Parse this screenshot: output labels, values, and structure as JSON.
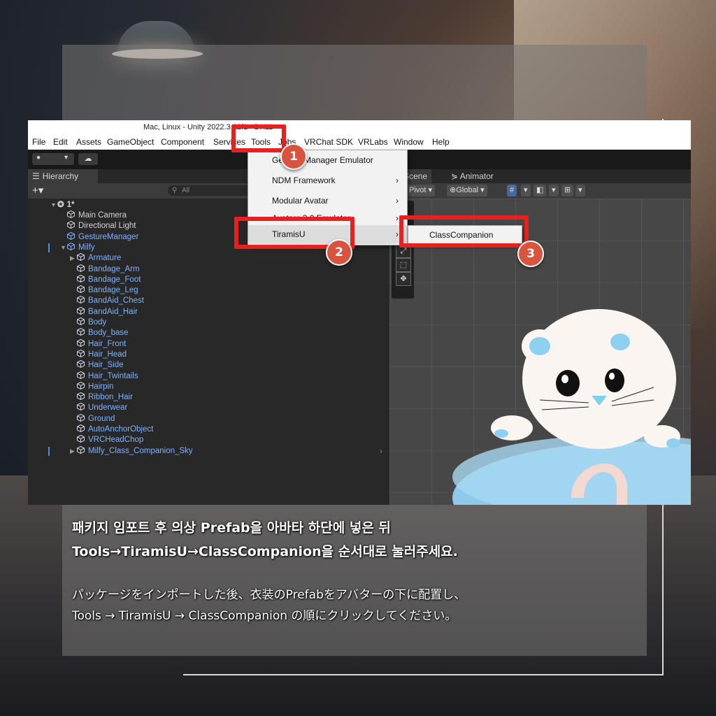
{
  "window": {
    "title": "Mac, Linux - Unity 2022.3.22f1 <DX11>"
  },
  "menubar": {
    "items": [
      "File",
      "Edit",
      "Assets",
      "GameObject",
      "Component",
      "Services",
      "Tools",
      "Jobs",
      "VRChat SDK",
      "VRLabs",
      "Window",
      "Help"
    ]
  },
  "hierarchy": {
    "tab_label": "Hierarchy",
    "search_placeholder": "All",
    "scene_name": "1*",
    "items": [
      {
        "label": "Main Camera",
        "depth": 1,
        "prefab": false
      },
      {
        "label": "Directional Light",
        "depth": 1,
        "prefab": false
      },
      {
        "label": "GestureManager",
        "depth": 1,
        "prefab": true
      },
      {
        "label": "Milfy",
        "depth": 1,
        "prefab": true
      },
      {
        "label": "Armature",
        "depth": 2,
        "prefab": true
      },
      {
        "label": "Bandage_Arm",
        "depth": 2,
        "prefab": true
      },
      {
        "label": "Bandage_Foot",
        "depth": 2,
        "prefab": true
      },
      {
        "label": "Bandage_Leg",
        "depth": 2,
        "prefab": true
      },
      {
        "label": "BandAid_Chest",
        "depth": 2,
        "prefab": true
      },
      {
        "label": "BandAid_Hair",
        "depth": 2,
        "prefab": true
      },
      {
        "label": "Body",
        "depth": 2,
        "prefab": true
      },
      {
        "label": "Body_base",
        "depth": 2,
        "prefab": true
      },
      {
        "label": "Hair_Front",
        "depth": 2,
        "prefab": true
      },
      {
        "label": "Hair_Head",
        "depth": 2,
        "prefab": true
      },
      {
        "label": "Hair_Side",
        "depth": 2,
        "prefab": true
      },
      {
        "label": "Hair_Twintails",
        "depth": 2,
        "prefab": true
      },
      {
        "label": "Hairpin",
        "depth": 2,
        "prefab": true
      },
      {
        "label": "Ribbon_Hair",
        "depth": 2,
        "prefab": true
      },
      {
        "label": "Underwear",
        "depth": 2,
        "prefab": true
      },
      {
        "label": "Ground",
        "depth": 2,
        "prefab": true
      },
      {
        "label": "AutoAnchorObject",
        "depth": 2,
        "prefab": true
      },
      {
        "label": "VRCHeadChop",
        "depth": 2,
        "prefab": true
      },
      {
        "label": "Milfy_Class_Companion_Sky",
        "depth": 2,
        "prefab": true
      }
    ]
  },
  "scene_view": {
    "tabs": [
      "Scene",
      "Animator"
    ],
    "pivot_label": "Pivot",
    "global_label": "Global"
  },
  "tools_menu": {
    "items": [
      {
        "label": "Gesture Manager Emulator",
        "has_sub": false
      },
      {
        "label": "NDM Framework",
        "has_sub": true
      },
      {
        "label": "Modular Avatar",
        "has_sub": true
      },
      {
        "label": "Avatars 3.0 Emulator",
        "has_sub": true
      },
      {
        "label": "TiramisU",
        "has_sub": true
      }
    ],
    "submenu_item": "ClassCompanion"
  },
  "steps": [
    "1",
    "2",
    "3"
  ],
  "captions": {
    "ko_line1": "패키지 임포트 후 의상 Prefab을 아바타 하단에 넣은 뒤",
    "ko_line2": "Tools→TiramisU→ClassCompanion을 순서대로 눌러주세요.",
    "ja_line1": "パッケージをインポートした後、衣装のPrefabをアバターの下に配置し、",
    "ja_line2": "Tools → TiramisU → ClassCompanion の順にクリックしてください。"
  },
  "colors": {
    "highlight": "#e8201f",
    "badge": "#d8543e",
    "prefab_text": "#7fb2ff"
  }
}
